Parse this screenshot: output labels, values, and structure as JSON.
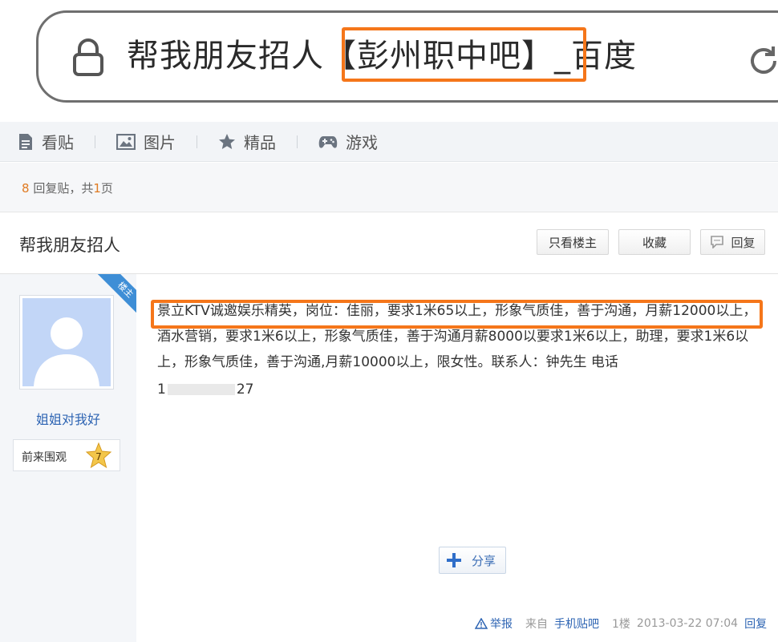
{
  "browser": {
    "url_title": "帮我朋友招人【彭州职中吧】_百度",
    "highlight_color": "#f5761a"
  },
  "nav": {
    "items": [
      {
        "label": "看贴",
        "icon": "document-icon"
      },
      {
        "label": "图片",
        "icon": "image-icon"
      },
      {
        "label": "精品",
        "icon": "star-icon"
      },
      {
        "label": "游戏",
        "icon": "gamepad-icon"
      }
    ]
  },
  "thread": {
    "reply_count": "8",
    "reply_count_label": "回复贴，共",
    "page_count": "1",
    "page_label": "页",
    "title": "帮我朋友招人",
    "btn_only_op": "只看楼主",
    "btn_favorite": "收藏",
    "btn_reply": "回复"
  },
  "post": {
    "op_badge": "楼主",
    "username": "姐姐对我好",
    "level_title": "前来围观",
    "level_num": "7",
    "content": "景立KTV诚邀娱乐精英，岗位：佳丽，要求1米65以上，形象气质佳，善于沟通，月薪12000以上，酒水营销，要求1米6以上，形象气质佳，善于沟通月薪8000以要求1米6以上，助理，要求1米6以上，形象气质佳，善于沟通,月薪10000以上，限女性。联系人：钟先生 电话",
    "phone_start": "1",
    "phone_end": "27",
    "share_label": "分享",
    "report_label": "举报",
    "source_prefix": "来自",
    "source_link": "手机贴吧",
    "floor": "1楼",
    "timestamp": "2013-03-22 07:04",
    "reply_label": "回复"
  }
}
